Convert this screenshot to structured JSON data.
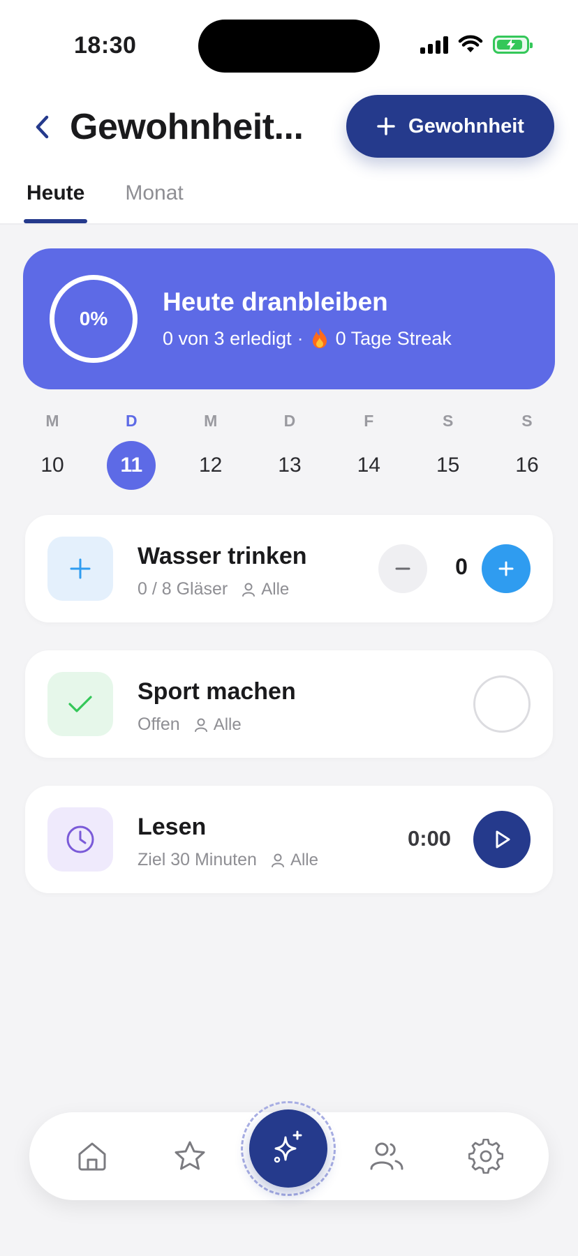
{
  "status_bar": {
    "time": "18:30"
  },
  "header": {
    "title": "Gewohnheit...",
    "add_label": "Gewohnheit"
  },
  "tabs": [
    {
      "label": "Heute",
      "active": true
    },
    {
      "label": "Monat",
      "active": false
    }
  ],
  "summary": {
    "percent_label": "0%",
    "progress": 0,
    "title": "Heute dranbleiben",
    "done_text": "0 von 3 erledigt",
    "separator": "·",
    "streak_text": "0 Tage Streak"
  },
  "week": [
    {
      "letter": "M",
      "num": "10",
      "active": false
    },
    {
      "letter": "D",
      "num": "11",
      "active": true
    },
    {
      "letter": "M",
      "num": "12",
      "active": false
    },
    {
      "letter": "D",
      "num": "13",
      "active": false
    },
    {
      "letter": "F",
      "num": "14",
      "active": false
    },
    {
      "letter": "S",
      "num": "15",
      "active": false
    },
    {
      "letter": "S",
      "num": "16",
      "active": false
    }
  ],
  "habits": {
    "water": {
      "name": "Wasser trinken",
      "progress": "0 / 8 Gläser",
      "who": "Alle",
      "count": "0",
      "icon": "plus-icon"
    },
    "sport": {
      "name": "Sport machen",
      "status": "Offen",
      "who": "Alle",
      "icon": "check-icon"
    },
    "read": {
      "name": "Lesen",
      "goal": "Ziel 30 Minuten",
      "who": "Alle",
      "timer": "0:00",
      "icon": "clock-icon"
    }
  },
  "nav": {
    "items": [
      "home-icon",
      "star-icon",
      "sparkles-icon",
      "users-icon",
      "gear-icon"
    ]
  },
  "colors": {
    "primary": "#253a8c",
    "accent": "#5d6ae6",
    "water_blue": "#2f9cf0",
    "water_tint": "#e4f0fc",
    "sport_green": "#34c759",
    "sport_tint": "#e6f7ea",
    "read_purple": "#7a5ad8",
    "read_tint": "#efeafc"
  }
}
